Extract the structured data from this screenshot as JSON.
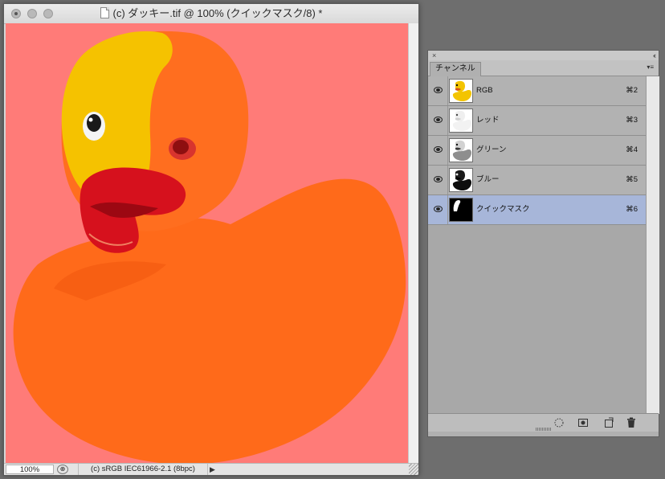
{
  "document": {
    "title": "(c) ダッキー.tif @ 100% (クイックマスク/8) *",
    "zoom": "100%",
    "doc_info": "(c) sRGB IEC61966-2.1 (8bpc)",
    "proof_icon": "⊕",
    "status_arrow": "▶",
    "overlay_color": "#ff7b78"
  },
  "panel": {
    "close_glyph": "×",
    "collapse_glyph": "‹‹",
    "tab_label": "チャンネル",
    "menu_glyph": "▾≡",
    "channels": [
      {
        "label": "RGB",
        "shortcut": "⌘2",
        "thumb": "color-thumb"
      },
      {
        "label": "レッド",
        "shortcut": "⌘3",
        "thumb": "grayscale-light-thumb"
      },
      {
        "label": "グリーン",
        "shortcut": "⌘4",
        "thumb": "grayscale-mid-thumb"
      },
      {
        "label": "ブルー",
        "shortcut": "⌘5",
        "thumb": "grayscale-dark-thumb"
      },
      {
        "label": "クイックマスク",
        "shortcut": "⌘6",
        "thumb": "mask-thumb"
      }
    ],
    "selected_channel": "クイックマスク",
    "footer_icons": [
      "load-selection-icon",
      "save-selection-icon",
      "new-channel-icon",
      "trash-icon"
    ]
  },
  "colors": {
    "selection_highlight": "#a7b6d9",
    "quickmask_overlay": "#ff7b78",
    "duck_orange": "#ff6a1a"
  }
}
